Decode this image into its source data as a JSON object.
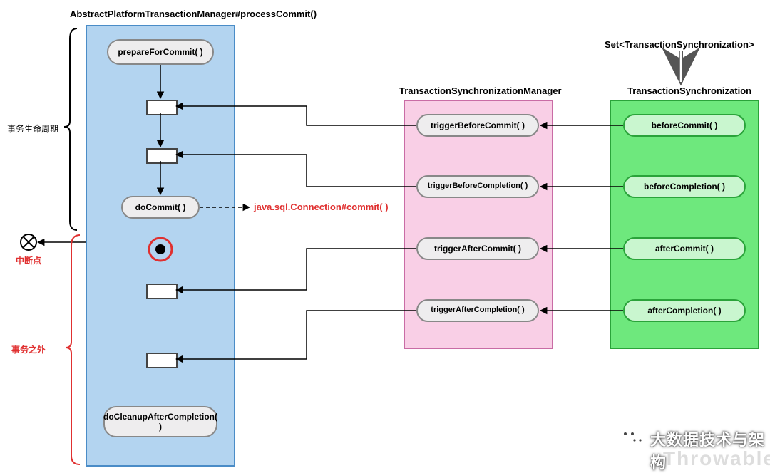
{
  "titles": {
    "main": "AbstractPlatformTransactionManager#processCommit()",
    "syncMgr": "TransactionSynchronizationManager",
    "sync": "TransactionSynchronization",
    "setSync": "Set<TransactionSynchronization>"
  },
  "blue": {
    "prepare": "prepareForCommit( )",
    "doCommit": "doCommit( )",
    "cleanup": "doCleanupAfterCompletion( )"
  },
  "pink": {
    "trigBeforeCommit": "triggerBeforeCommit( )",
    "trigBeforeCompletion": "triggerBeforeCompletion( )",
    "trigAfterCommit": "triggerAfterCommit( )",
    "trigAfterCompletion": "triggerAfterCompletion( )"
  },
  "green": {
    "beforeCommit": "beforeCommit( )",
    "beforeCompletion": "beforeCompletion( )",
    "afterCommit": "afterCommit( )",
    "afterCompletion": "afterCompletion( )"
  },
  "annotations": {
    "lifecycle": "事务生命周期",
    "breakpoint": "中断点",
    "outside": "事务之外",
    "commitCall": "java.sql.Connection#commit( )"
  },
  "watermark": {
    "chat": "大数据技术与架构",
    "throwable": "Throwable"
  }
}
